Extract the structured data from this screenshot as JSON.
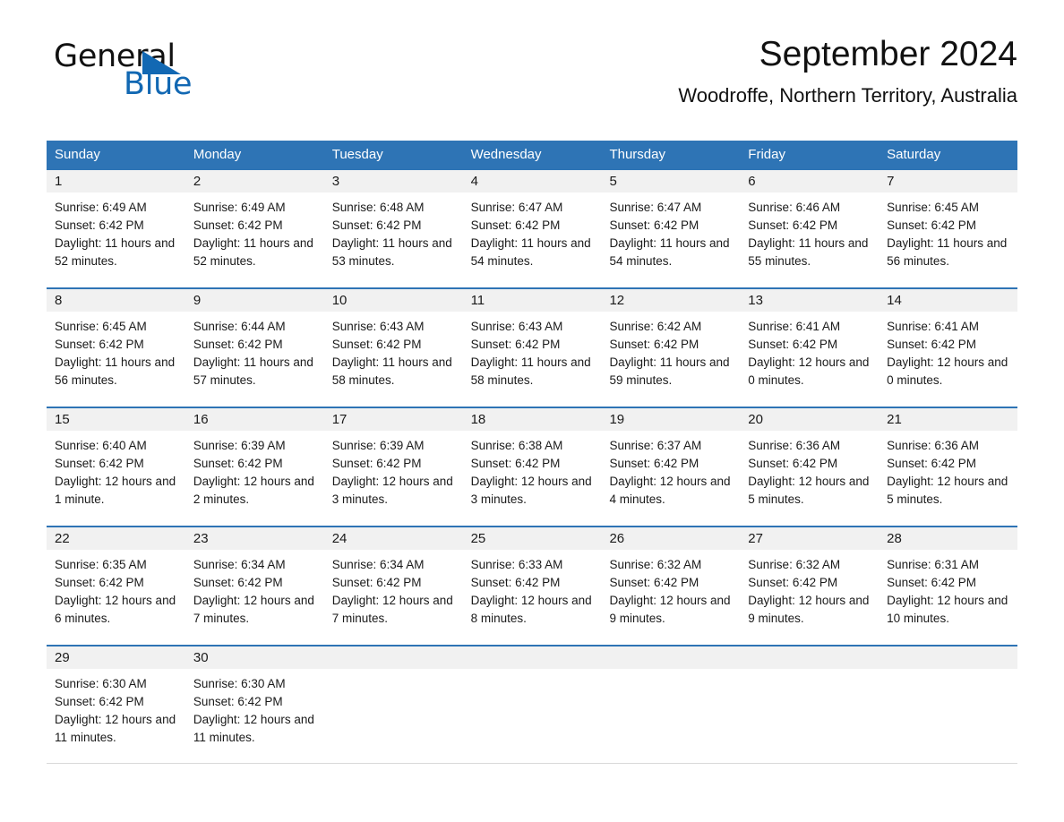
{
  "brand": {
    "name_part1": "General",
    "name_part2": "Blue",
    "triangle_icon": "brand-triangle-icon",
    "accent_color": "#1268b3"
  },
  "header": {
    "title": "September 2024",
    "subtitle": "Woodroffe, Northern Territory, Australia"
  },
  "theme": {
    "header_blue": "#2e74b5",
    "day_band_gray": "#f1f1f1",
    "text": "#1a1a1a"
  },
  "calendar": {
    "weekdays": [
      "Sunday",
      "Monday",
      "Tuesday",
      "Wednesday",
      "Thursday",
      "Friday",
      "Saturday"
    ],
    "weeks": [
      [
        {
          "day": "1",
          "sunrise": "Sunrise: 6:49 AM",
          "sunset": "Sunset: 6:42 PM",
          "daylight": "Daylight: 11 hours and 52 minutes."
        },
        {
          "day": "2",
          "sunrise": "Sunrise: 6:49 AM",
          "sunset": "Sunset: 6:42 PM",
          "daylight": "Daylight: 11 hours and 52 minutes."
        },
        {
          "day": "3",
          "sunrise": "Sunrise: 6:48 AM",
          "sunset": "Sunset: 6:42 PM",
          "daylight": "Daylight: 11 hours and 53 minutes."
        },
        {
          "day": "4",
          "sunrise": "Sunrise: 6:47 AM",
          "sunset": "Sunset: 6:42 PM",
          "daylight": "Daylight: 11 hours and 54 minutes."
        },
        {
          "day": "5",
          "sunrise": "Sunrise: 6:47 AM",
          "sunset": "Sunset: 6:42 PM",
          "daylight": "Daylight: 11 hours and 54 minutes."
        },
        {
          "day": "6",
          "sunrise": "Sunrise: 6:46 AM",
          "sunset": "Sunset: 6:42 PM",
          "daylight": "Daylight: 11 hours and 55 minutes."
        },
        {
          "day": "7",
          "sunrise": "Sunrise: 6:45 AM",
          "sunset": "Sunset: 6:42 PM",
          "daylight": "Daylight: 11 hours and 56 minutes."
        }
      ],
      [
        {
          "day": "8",
          "sunrise": "Sunrise: 6:45 AM",
          "sunset": "Sunset: 6:42 PM",
          "daylight": "Daylight: 11 hours and 56 minutes."
        },
        {
          "day": "9",
          "sunrise": "Sunrise: 6:44 AM",
          "sunset": "Sunset: 6:42 PM",
          "daylight": "Daylight: 11 hours and 57 minutes."
        },
        {
          "day": "10",
          "sunrise": "Sunrise: 6:43 AM",
          "sunset": "Sunset: 6:42 PM",
          "daylight": "Daylight: 11 hours and 58 minutes."
        },
        {
          "day": "11",
          "sunrise": "Sunrise: 6:43 AM",
          "sunset": "Sunset: 6:42 PM",
          "daylight": "Daylight: 11 hours and 58 minutes."
        },
        {
          "day": "12",
          "sunrise": "Sunrise: 6:42 AM",
          "sunset": "Sunset: 6:42 PM",
          "daylight": "Daylight: 11 hours and 59 minutes."
        },
        {
          "day": "13",
          "sunrise": "Sunrise: 6:41 AM",
          "sunset": "Sunset: 6:42 PM",
          "daylight": "Daylight: 12 hours and 0 minutes."
        },
        {
          "day": "14",
          "sunrise": "Sunrise: 6:41 AM",
          "sunset": "Sunset: 6:42 PM",
          "daylight": "Daylight: 12 hours and 0 minutes."
        }
      ],
      [
        {
          "day": "15",
          "sunrise": "Sunrise: 6:40 AM",
          "sunset": "Sunset: 6:42 PM",
          "daylight": "Daylight: 12 hours and 1 minute."
        },
        {
          "day": "16",
          "sunrise": "Sunrise: 6:39 AM",
          "sunset": "Sunset: 6:42 PM",
          "daylight": "Daylight: 12 hours and 2 minutes."
        },
        {
          "day": "17",
          "sunrise": "Sunrise: 6:39 AM",
          "sunset": "Sunset: 6:42 PM",
          "daylight": "Daylight: 12 hours and 3 minutes."
        },
        {
          "day": "18",
          "sunrise": "Sunrise: 6:38 AM",
          "sunset": "Sunset: 6:42 PM",
          "daylight": "Daylight: 12 hours and 3 minutes."
        },
        {
          "day": "19",
          "sunrise": "Sunrise: 6:37 AM",
          "sunset": "Sunset: 6:42 PM",
          "daylight": "Daylight: 12 hours and 4 minutes."
        },
        {
          "day": "20",
          "sunrise": "Sunrise: 6:36 AM",
          "sunset": "Sunset: 6:42 PM",
          "daylight": "Daylight: 12 hours and 5 minutes."
        },
        {
          "day": "21",
          "sunrise": "Sunrise: 6:36 AM",
          "sunset": "Sunset: 6:42 PM",
          "daylight": "Daylight: 12 hours and 5 minutes."
        }
      ],
      [
        {
          "day": "22",
          "sunrise": "Sunrise: 6:35 AM",
          "sunset": "Sunset: 6:42 PM",
          "daylight": "Daylight: 12 hours and 6 minutes."
        },
        {
          "day": "23",
          "sunrise": "Sunrise: 6:34 AM",
          "sunset": "Sunset: 6:42 PM",
          "daylight": "Daylight: 12 hours and 7 minutes."
        },
        {
          "day": "24",
          "sunrise": "Sunrise: 6:34 AM",
          "sunset": "Sunset: 6:42 PM",
          "daylight": "Daylight: 12 hours and 7 minutes."
        },
        {
          "day": "25",
          "sunrise": "Sunrise: 6:33 AM",
          "sunset": "Sunset: 6:42 PM",
          "daylight": "Daylight: 12 hours and 8 minutes."
        },
        {
          "day": "26",
          "sunrise": "Sunrise: 6:32 AM",
          "sunset": "Sunset: 6:42 PM",
          "daylight": "Daylight: 12 hours and 9 minutes."
        },
        {
          "day": "27",
          "sunrise": "Sunrise: 6:32 AM",
          "sunset": "Sunset: 6:42 PM",
          "daylight": "Daylight: 12 hours and 9 minutes."
        },
        {
          "day": "28",
          "sunrise": "Sunrise: 6:31 AM",
          "sunset": "Sunset: 6:42 PM",
          "daylight": "Daylight: 12 hours and 10 minutes."
        }
      ],
      [
        {
          "day": "29",
          "sunrise": "Sunrise: 6:30 AM",
          "sunset": "Sunset: 6:42 PM",
          "daylight": "Daylight: 12 hours and 11 minutes."
        },
        {
          "day": "30",
          "sunrise": "Sunrise: 6:30 AM",
          "sunset": "Sunset: 6:42 PM",
          "daylight": "Daylight: 12 hours and 11 minutes."
        },
        {
          "day": "",
          "sunrise": "",
          "sunset": "",
          "daylight": ""
        },
        {
          "day": "",
          "sunrise": "",
          "sunset": "",
          "daylight": ""
        },
        {
          "day": "",
          "sunrise": "",
          "sunset": "",
          "daylight": ""
        },
        {
          "day": "",
          "sunrise": "",
          "sunset": "",
          "daylight": ""
        },
        {
          "day": "",
          "sunrise": "",
          "sunset": "",
          "daylight": ""
        }
      ]
    ]
  }
}
